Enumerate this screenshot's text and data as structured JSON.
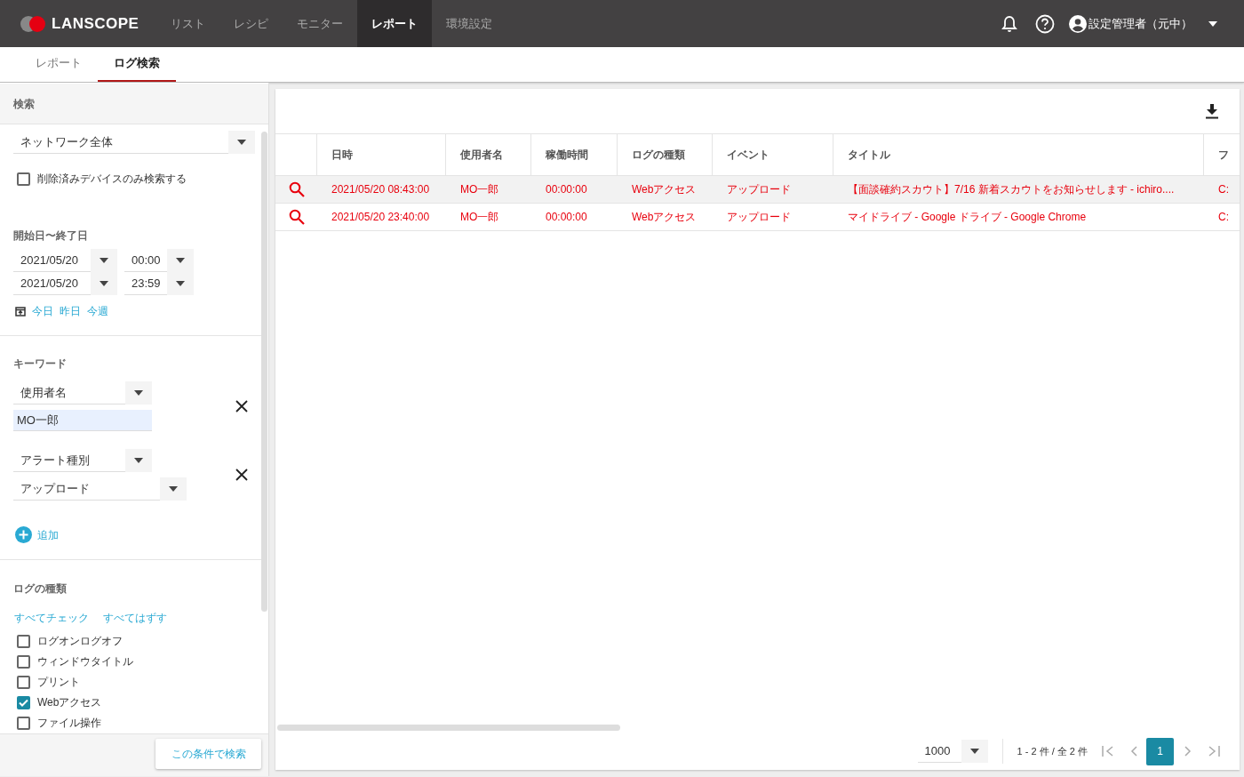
{
  "nav": {
    "logo": "LANSCOPE",
    "items": [
      {
        "label": "リスト",
        "selected": false
      },
      {
        "label": "レシピ",
        "selected": false
      },
      {
        "label": "モニター",
        "selected": false
      },
      {
        "label": "レポート",
        "selected": true
      },
      {
        "label": "環境設定",
        "selected": false
      }
    ],
    "user": "設定管理者（元中）"
  },
  "subtabs": [
    {
      "label": "レポート",
      "selected": false
    },
    {
      "label": "ログ検索",
      "selected": true
    }
  ],
  "search_panel": {
    "title": "検索",
    "scope": "ネットワーク全体",
    "deleted_only": {
      "label": "削除済みデバイスのみ検索する",
      "checked": false
    },
    "period": {
      "label": "開始日〜終了日",
      "start_date": "2021/05/20",
      "start_time": "00:00",
      "end_date": "2021/05/20",
      "end_time": "23:59",
      "shortcuts": [
        "今日",
        "昨日",
        "今週"
      ]
    },
    "keyword": {
      "label": "キーワード",
      "conditions": [
        {
          "field": "使用者名",
          "kind": "text",
          "value": "MO一郎"
        },
        {
          "field": "アラート種別",
          "kind": "select",
          "value": "アップロード"
        }
      ],
      "add": "追加"
    },
    "log_types": {
      "label": "ログの種類",
      "check_all": "すべてチェック",
      "uncheck_all": "すべてはずす",
      "items": [
        {
          "label": "ログオンログオフ",
          "checked": false
        },
        {
          "label": "ウィンドウタイトル",
          "checked": false
        },
        {
          "label": "プリント",
          "checked": false
        },
        {
          "label": "Webアクセス",
          "checked": true
        },
        {
          "label": "ファイル操作",
          "checked": false
        }
      ]
    },
    "submit": "この条件で検索"
  },
  "table": {
    "columns": [
      "日時",
      "使用者名",
      "稼働時間",
      "ログの種類",
      "イベント",
      "タイトル",
      "フ"
    ],
    "rows": [
      {
        "selected": true,
        "cells": [
          "2021/05/20 08:43:00",
          "MO一郎",
          "00:00:00",
          "Webアクセス",
          "アップロード",
          "【面談確約スカウト】7/16 新着スカウトをお知らせします - ichiro....",
          "C:"
        ]
      },
      {
        "selected": false,
        "cells": [
          "2021/05/20 23:40:00",
          "MO一郎",
          "00:00:00",
          "Webアクセス",
          "アップロード",
          "マイドライブ - Google ドライブ - Google Chrome",
          "C:"
        ]
      }
    ]
  },
  "pagination": {
    "page_size": "1000",
    "range": "1 - 2 件 / 全 2 件",
    "pages": [
      {
        "label": "1",
        "selected": true
      }
    ]
  }
}
